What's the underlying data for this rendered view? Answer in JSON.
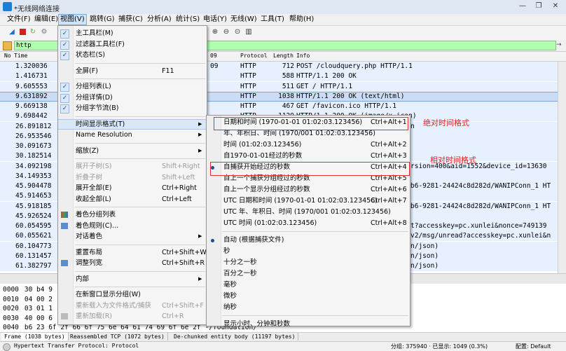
{
  "window": {
    "title": "*无线网络连接",
    "controls": [
      "—",
      "❐",
      "✕"
    ]
  },
  "menubar": [
    "文件(F)",
    "编辑(E)",
    "视图(V)",
    "跳转(G)",
    "捕获(C)",
    "分析(A)",
    "统计(S)",
    "电话(Y)",
    "无线(W)",
    "工具(T)",
    "帮助(H)"
  ],
  "filter": {
    "value": "http"
  },
  "packet_list": {
    "headers": [
      "No",
      "Time",
      "Protocol",
      "Length",
      "Info"
    ],
    "header_fragment": "09",
    "rows": [
      {
        "time": "1.320036",
        "protocol": "HTTP",
        "length": "712",
        "info": "POST /cloudquery.php HTTP/1.1",
        "dest_tail": "09"
      },
      {
        "time": "1.416731",
        "protocol": "HTTP",
        "length": "588",
        "info": "HTTP/1.1 200 OK"
      },
      {
        "time": "9.605553",
        "protocol": "HTTP",
        "length": "511",
        "info": "GET / HTTP/1.1"
      },
      {
        "time": "9.631892",
        "protocol": "HTTP",
        "length": "1038",
        "info": "HTTP/1.1 200 OK  (text/html)",
        "selected": true
      },
      {
        "time": "9.669138",
        "protocol": "HTTP",
        "length": "467",
        "info": "GET /favicon.ico HTTP/1.1"
      },
      {
        "time": "9.698442",
        "protocol": "HTTP",
        "length": "1129",
        "info": "HTTP/1.1 200 OK  (image/x-icon)"
      },
      {
        "time": "26.891812",
        "info_tail": "n"
      },
      {
        "time": "26.953546",
        "info_tail": ""
      },
      {
        "time": "30.091673",
        "info_tail": ""
      },
      {
        "time": "30.182514",
        "info_tail": ""
      },
      {
        "time": "34.092198",
        "info_tail": "rsion=400&aid=1552&device_id=13630"
      },
      {
        "time": "34.149353",
        "info_tail": ""
      },
      {
        "time": "45.904478",
        "info_tail": "b6-9281-24424c8d282d/WANIPConn_1 HT"
      },
      {
        "time": "45.914653",
        "info_tail": ""
      },
      {
        "time": "45.918185",
        "info_tail": "b6-9281-24424c8d282d/WANIPConn_1 HT"
      },
      {
        "time": "45.926524",
        "info_tail": ""
      },
      {
        "time": "60.054595",
        "info_tail": "t?accesskey=pc.xunlei&nonce=749139"
      },
      {
        "time": "60.055621",
        "info_tail": "v2/msg/unread?accesskey=pc.xunlei&n"
      },
      {
        "time": "60.104773",
        "info_tail": "n/json)"
      },
      {
        "time": "60.131457",
        "info_tail": "n/json)"
      },
      {
        "time": "61.382797",
        "info_tail": "n/json)"
      }
    ]
  },
  "bytes_pane": {
    "rows": [
      {
        "offset": "0000",
        "hex": "30 b4 9"
      },
      {
        "offset": "0010",
        "hex": "04 00 2"
      },
      {
        "offset": "0020",
        "hex": "03 01 1"
      },
      {
        "offset": "0030",
        "hex": "40 00 6"
      },
      {
        "offset": "0040",
        "hex": "b6 23 6f 2f 66 6f 75 6e  64 61 74 69 6f 6e 2f",
        "ascii": "-/foundation/"
      }
    ],
    "tabs": [
      "Frame (1038 bytes)",
      "Reassembled TCP (1072 bytes)",
      "De-chunked entity body (11197 bytes)"
    ]
  },
  "statusbar": {
    "protocol": "Hypertext Transfer Protocol: Protocol",
    "packets": "分组: 375940 · 已显示: 1049 (0.3%)",
    "profile": "配置: Default"
  },
  "view_menu": {
    "items": [
      {
        "label": "主工具栏(M)",
        "checked": true
      },
      {
        "label": "过滤器工具栏(F)",
        "checked": true
      },
      {
        "label": "状态栏(S)",
        "checked": true
      },
      {
        "sep": true
      },
      {
        "label": "全屏(F)",
        "shortcut": "F11"
      },
      {
        "sep": true
      },
      {
        "label": "分组列表(L)",
        "checked": true
      },
      {
        "label": "分组详情(D)",
        "checked": true
      },
      {
        "label": "分组字节流(B)",
        "checked": true
      },
      {
        "sep": true
      },
      {
        "label": "时间显示格式(T)",
        "submenu": true,
        "highlighted": true
      },
      {
        "label": "Name Resolution",
        "submenu": true
      },
      {
        "sep": true
      },
      {
        "label": "缩放(Z)",
        "submenu": true
      },
      {
        "sep": true
      },
      {
        "label": "展开子树(S)",
        "shortcut": "Shift+Right",
        "disabled": true
      },
      {
        "label": "折叠子树",
        "shortcut": "Shift+Left",
        "disabled": true
      },
      {
        "label": "展开全部(E)",
        "shortcut": "Ctrl+Right"
      },
      {
        "label": "收起全部(L)",
        "shortcut": "Ctrl+Left"
      },
      {
        "sep": true
      },
      {
        "label": "着色分组列表",
        "icon": "colorize-icon"
      },
      {
        "label": "着色规则(C)...",
        "icon": "coloring-rules-icon"
      },
      {
        "label": "对话着色",
        "submenu": true
      },
      {
        "sep": true
      },
      {
        "label": "重置布局",
        "shortcut": "Ctrl+Shift+W"
      },
      {
        "label": "调整列宽",
        "shortcut": "Ctrl+Shift+R",
        "icon": "resize-columns-icon"
      },
      {
        "sep": true
      },
      {
        "label": "内部",
        "submenu": true
      },
      {
        "sep": true
      },
      {
        "label": "在新窗口显示分组(W)"
      },
      {
        "label": "重新载入为文件格式/捕获",
        "shortcut": "Ctrl+Shift+F",
        "disabled": true
      },
      {
        "label": "重新加载(R)",
        "shortcut": "Ctrl+R",
        "disabled": true,
        "icon": "reload-icon"
      }
    ]
  },
  "time_submenu": {
    "items": [
      {
        "label": "日期和时间 (1970-01-01 01:02:03.123456)",
        "shortcut": "Ctrl+Alt+1"
      },
      {
        "label": "年、年积日、时间 (1970/001 01:02:03.123456)"
      },
      {
        "label": "时间 (01:02:03.123456)",
        "shortcut": "Ctrl+Alt+2"
      },
      {
        "label": "自1970-01-01经过的秒数",
        "shortcut": "Ctrl+Alt+3"
      },
      {
        "label": "自捕获开始经过的秒数",
        "shortcut": "Ctrl+Alt+4",
        "selected": true
      },
      {
        "label": "自上一个捕获分组经过的秒数",
        "shortcut": "Ctrl+Alt+5"
      },
      {
        "label": "自上一个显示分组经过的秒数",
        "shortcut": "Ctrl+Alt+6"
      },
      {
        "label": "UTC 日期和时间 (1970-01-01 01:02:03.123456)",
        "shortcut": "Ctrl+Alt+7"
      },
      {
        "label": "UTC 年、年积日、时间 (1970/001 01:02:03.123456)"
      },
      {
        "label": "UTC 时间 (01:02:03.123456)",
        "shortcut": "Ctrl+Alt+8"
      },
      {
        "sep": true
      },
      {
        "label": "自动 (根据捕获文件)",
        "selected": true
      },
      {
        "label": "秒"
      },
      {
        "label": "十分之一秒"
      },
      {
        "label": "百分之一秒"
      },
      {
        "label": "毫秒"
      },
      {
        "label": "微秒"
      },
      {
        "label": "纳秒"
      },
      {
        "sep": true
      },
      {
        "label": "显示小时、分钟和秒数"
      }
    ]
  },
  "annotations": {
    "absolute": "绝对时间格式",
    "relative": "相对时间格式",
    "color": "#e02020"
  }
}
